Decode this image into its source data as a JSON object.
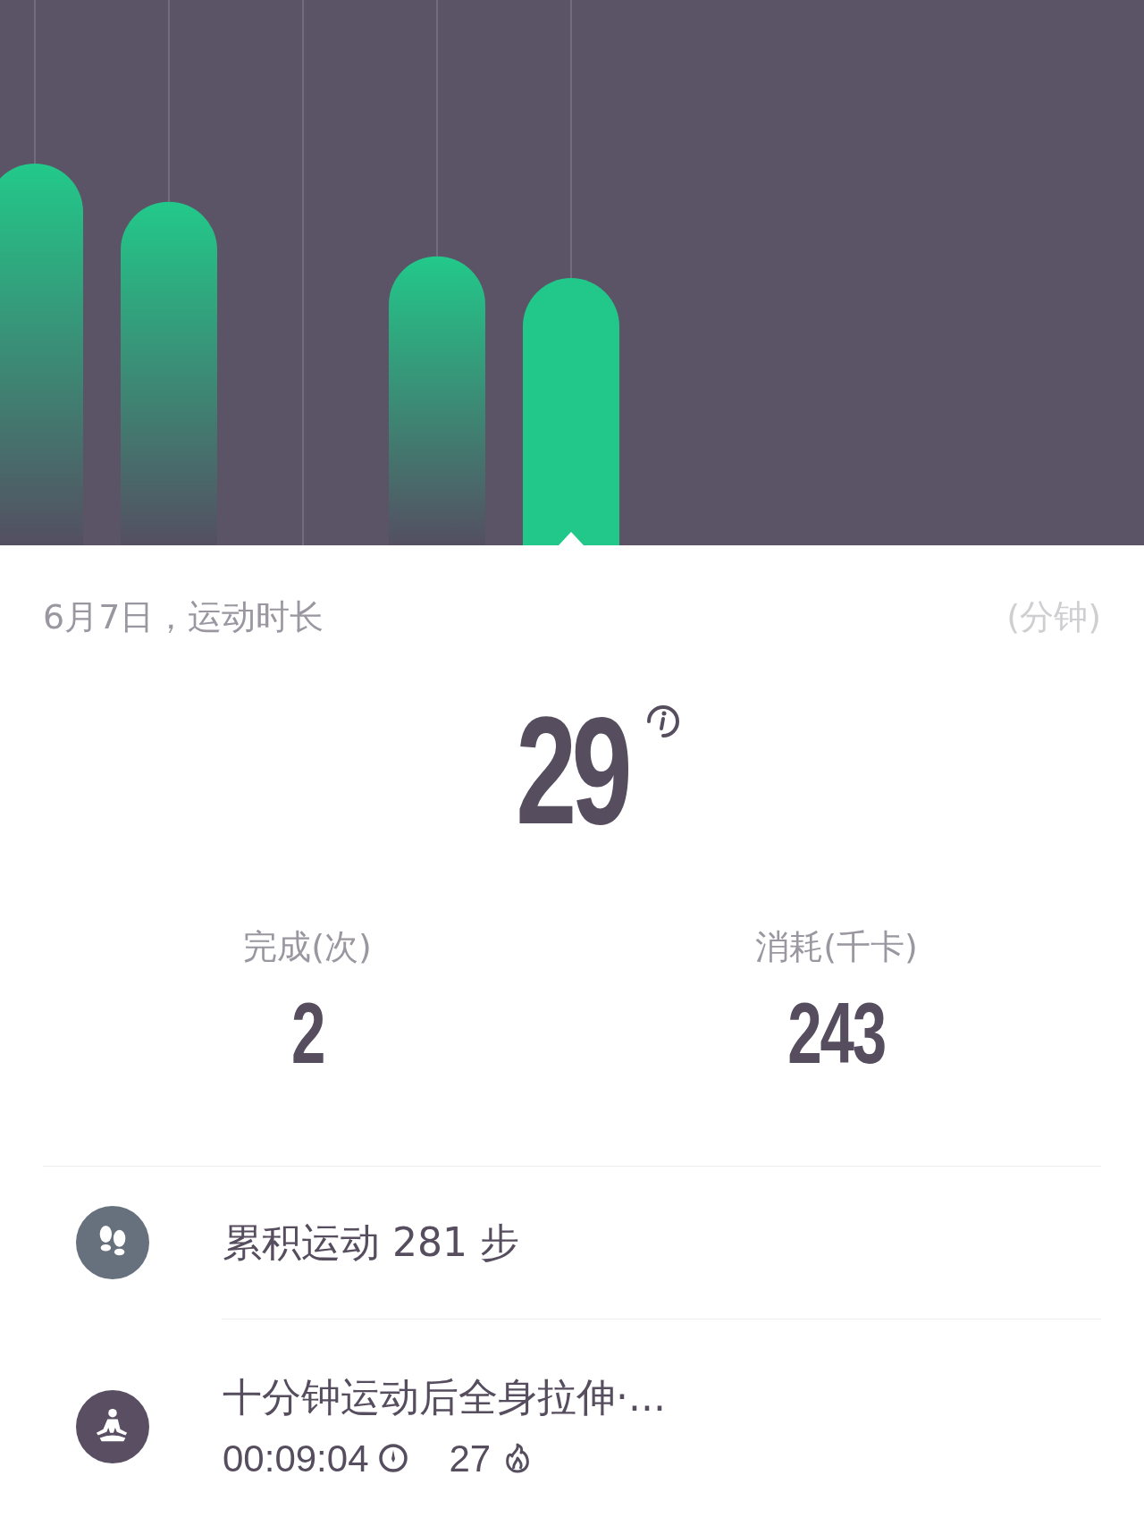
{
  "header": {
    "title": "6月7日，运动时长",
    "unit": "(分钟)"
  },
  "total": {
    "value": "29"
  },
  "stats": [
    {
      "label": "完成(次)",
      "value": "2"
    },
    {
      "label": "消耗(千卡)",
      "value": "243"
    }
  ],
  "records": [
    {
      "kind": "steps",
      "title": "累积运动 281 步"
    },
    {
      "kind": "workout",
      "title": "十分钟运动后全身拉伸·...",
      "duration": "00:09:04",
      "calories": "27"
    }
  ]
}
